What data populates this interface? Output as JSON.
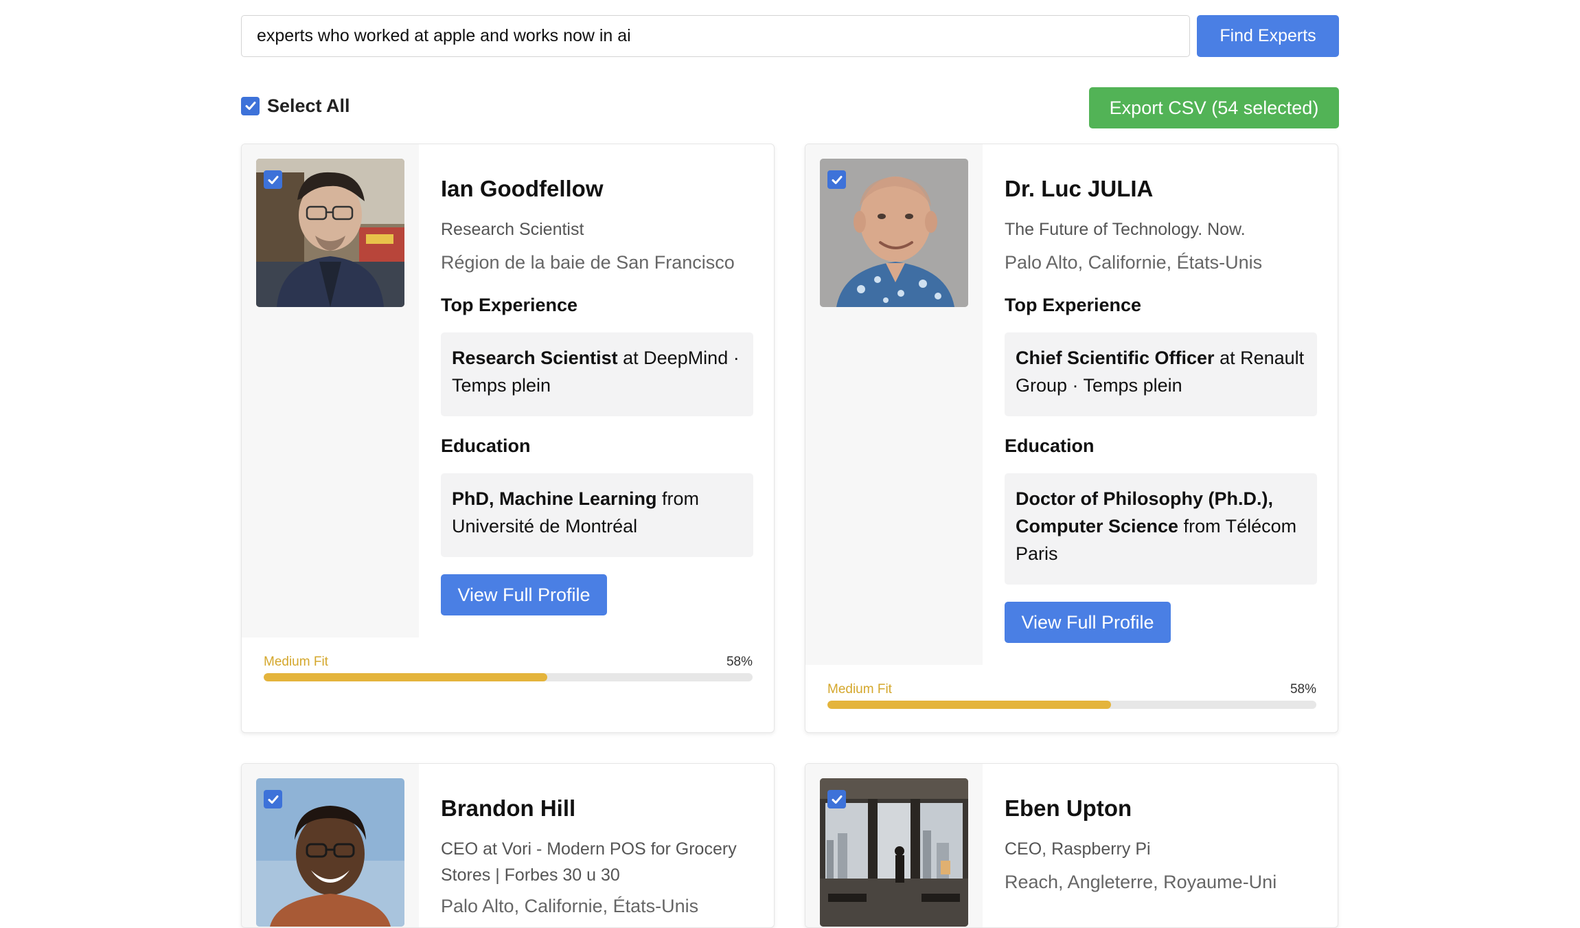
{
  "search": {
    "value": "experts who worked at apple and works now in ai",
    "button_label": "Find Experts"
  },
  "controls": {
    "select_all_label": "Select All",
    "select_all_checked": true,
    "export_label": "Export CSV (54 selected)"
  },
  "colors": {
    "primary": "#4a7fe4",
    "export": "#52b356",
    "fit_medium": "#e4b43c"
  },
  "experts": [
    {
      "name": "Ian Goodfellow",
      "headline": "Research Scientist",
      "location": "Région de la baie de San Francisco",
      "selected": true,
      "experience_title": "Top Experience",
      "experience_role": "Research Scientist",
      "experience_rest": " at DeepMind · Temps plein",
      "education_title": "Education",
      "education_degree": "PhD, Machine Learning",
      "education_rest": " from Université de Montréal",
      "profile_button": "View Full Profile",
      "fit_label": "Medium Fit",
      "fit_percent": 58,
      "fit_percent_text": "58%"
    },
    {
      "name": "Dr. Luc JULIA",
      "headline": "The Future of Technology. Now.",
      "location": "Palo Alto, Californie, États-Unis",
      "selected": true,
      "experience_title": "Top Experience",
      "experience_role": "Chief Scientific Officer",
      "experience_rest": " at Renault Group · Temps plein",
      "education_title": "Education",
      "education_degree": "Doctor of Philosophy (Ph.D.), Computer Science",
      "education_rest": " from Télécom Paris",
      "profile_button": "View Full Profile",
      "fit_label": "Medium Fit",
      "fit_percent": 58,
      "fit_percent_text": "58%"
    },
    {
      "name": "Brandon Hill",
      "headline": "CEO at Vori - Modern POS for Grocery Stores | Forbes 30 u 30",
      "location": "Palo Alto, Californie, États-Unis",
      "selected": true
    },
    {
      "name": "Eben Upton",
      "headline": "CEO, Raspberry Pi",
      "location": "Reach, Angleterre, Royaume-Uni",
      "selected": true
    }
  ]
}
